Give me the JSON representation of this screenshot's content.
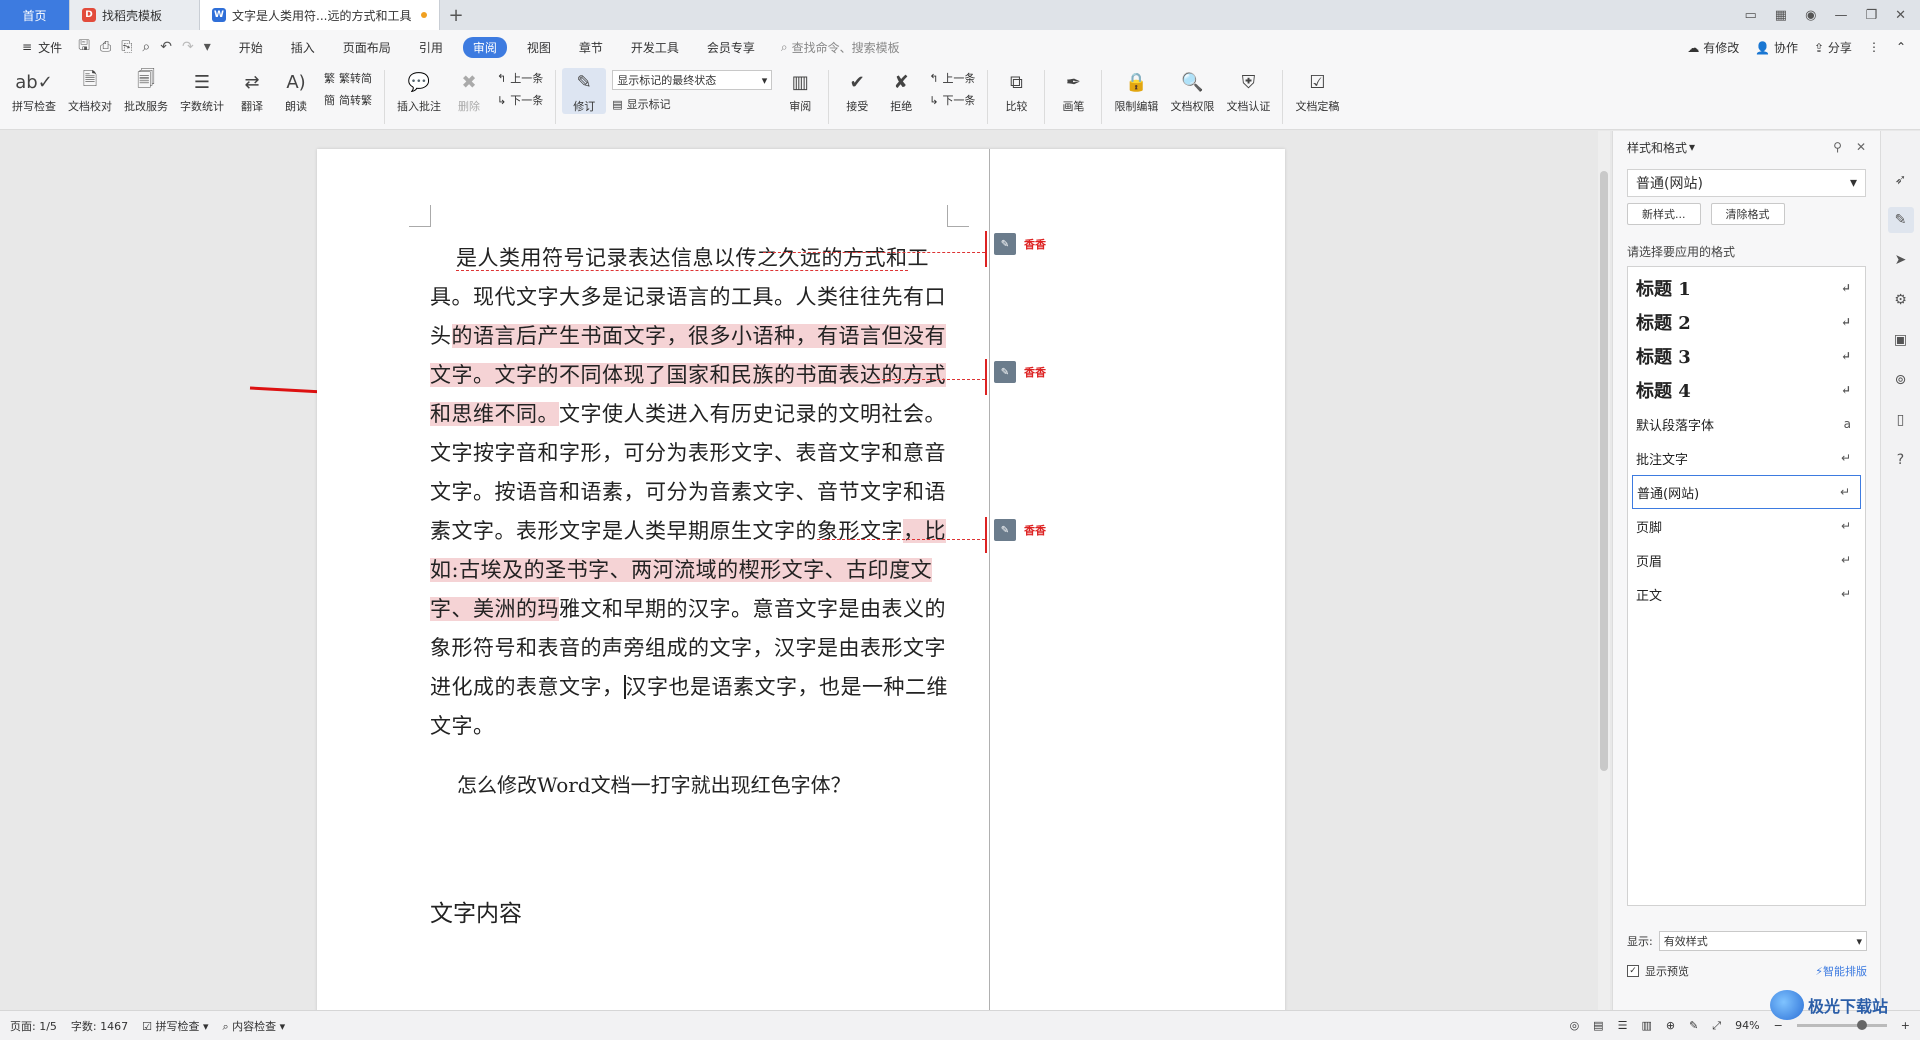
{
  "tabs": [
    {
      "label": "首页",
      "type": "home"
    },
    {
      "label": "找稻壳模板",
      "type": "template"
    },
    {
      "label": "文字是人类用符...远的方式和工具",
      "type": "doc",
      "modified": true
    }
  ],
  "menubar": {
    "file_label": "文件",
    "items": [
      "开始",
      "插入",
      "页面布局",
      "引用",
      "审阅",
      "视图",
      "章节",
      "开发工具",
      "会员专享"
    ],
    "active": "审阅",
    "search_placeholder": "查找命令、搜索模板",
    "right": {
      "changes": "有修改",
      "collab": "协作",
      "share": "分享"
    }
  },
  "ribbon": {
    "spell": "拼写检查",
    "proof": "文档校对",
    "review_service": "批改服务",
    "word_count": "字数统计",
    "translate": "翻译",
    "read": "朗读",
    "to_trad": "繁转简",
    "to_simp": "简转繁",
    "insert_comment": "插入批注",
    "delete": "删除",
    "prev": "上一条",
    "next": "下一条",
    "track": "修订",
    "markup_mode": "显示标记的最终状态",
    "show_markup": "显示标记",
    "reviewing": "审阅",
    "accept": "接受",
    "reject": "拒绝",
    "prev2": "上一条",
    "next2": "下一条",
    "compare": "比较",
    "ink": "画笔",
    "restrict": "限制编辑",
    "permission": "文档权限",
    "certify": "文档认证",
    "finalize": "文档定稿"
  },
  "document": {
    "paragraph_parts": [
      {
        "text": "是人类用符号记录表达信息以传之久远的方式和",
        "mark": "ins"
      },
      {
        "text": "工具。现代文字大多是记录语言的工具。人类往往先有口头",
        "mark": ""
      },
      {
        "text": "的语言后产生书面文字，很多小语种，有语言但没有文字。文字的不同体现了国家和民族的书面表达的方式和思维不同。",
        "mark": "hl"
      },
      {
        "text": "文字使人类进入有历史记录的文明社会。文字按字音和字形，可分为表形文字、表音文字和意音文字。按语音和语素，可分为音素文字、音节文字和语素文字。表形文字是人类早期原生文字的象形文字",
        "mark": ""
      },
      {
        "text": "，比如:古埃及的圣书字、两河流域的楔形文字、古印度文字、美洲的玛",
        "mark": "hl"
      },
      {
        "text": "雅文和早期的汉字。意音文字是由表义的象形符号和表音的声旁组成的文字，汉字是由表形文字进化成的表意文字，",
        "mark": ""
      },
      {
        "text": "汉字也是语素文字，也是一种二维文字。",
        "mark": ""
      }
    ],
    "question": "怎么修改Word文档一打字就出现红色字体？",
    "heading": "文字内容",
    "comments": [
      {
        "author": "香香"
      },
      {
        "author": "香香"
      },
      {
        "author": "香香"
      }
    ]
  },
  "panel": {
    "title": "样式和格式",
    "current_style": "普通(网站)",
    "new_style": "新样式...",
    "clear_format": "清除格式",
    "choose_label": "请选择要应用的格式",
    "styles": [
      {
        "name": "标题 1",
        "heading": true,
        "mark": "↵"
      },
      {
        "name": "标题 2",
        "heading": true,
        "mark": "↵"
      },
      {
        "name": "标题 3",
        "heading": true,
        "mark": "↵"
      },
      {
        "name": "标题 4",
        "heading": true,
        "mark": "↵"
      },
      {
        "name": "默认段落字体",
        "heading": false,
        "mark": "a"
      },
      {
        "name": "批注文字",
        "heading": false,
        "mark": "↵"
      },
      {
        "name": "普通(网站)",
        "heading": false,
        "mark": "↵",
        "selected": true
      },
      {
        "name": "页脚",
        "heading": false,
        "mark": "↵"
      },
      {
        "name": "页眉",
        "heading": false,
        "mark": "↵"
      },
      {
        "name": "正文",
        "heading": false,
        "mark": "↵"
      }
    ],
    "show_label": "显示:",
    "show_value": "有效样式",
    "preview_label": "显示预览",
    "smart_layout": "智能排版"
  },
  "status": {
    "page": "页面: 1/5",
    "words": "字数: 1467",
    "spell": "拼写检查",
    "content_check": "内容检查",
    "zoom": "94%"
  },
  "watermark": {
    "name": "极光下载站"
  }
}
